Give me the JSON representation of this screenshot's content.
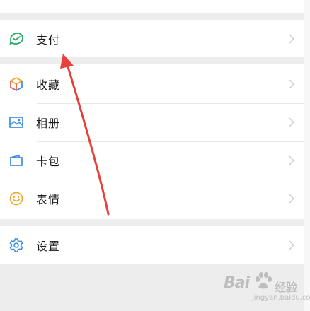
{
  "menu": {
    "pay": {
      "label": "支付",
      "icon": "wallet-icon"
    },
    "items": [
      {
        "label": "收藏",
        "icon": "favorites-cube-icon"
      },
      {
        "label": "相册",
        "icon": "album-image-icon"
      },
      {
        "label": "卡包",
        "icon": "card-wallet-icon"
      },
      {
        "label": "表情",
        "icon": "smiley-face-icon"
      }
    ],
    "settings": {
      "label": "设置",
      "icon": "gear-icon"
    }
  },
  "colors": {
    "background": "#ededed",
    "card": "#ffffff",
    "pay_green": "#2aae67",
    "accent_orange": "#f0a830",
    "accent_blue": "#3d8ee6",
    "annotation_red": "#e8403a"
  },
  "watermark": {
    "brand": "Bai",
    "brand_tail": "经验",
    "url": "jingyan.baidu.com"
  }
}
